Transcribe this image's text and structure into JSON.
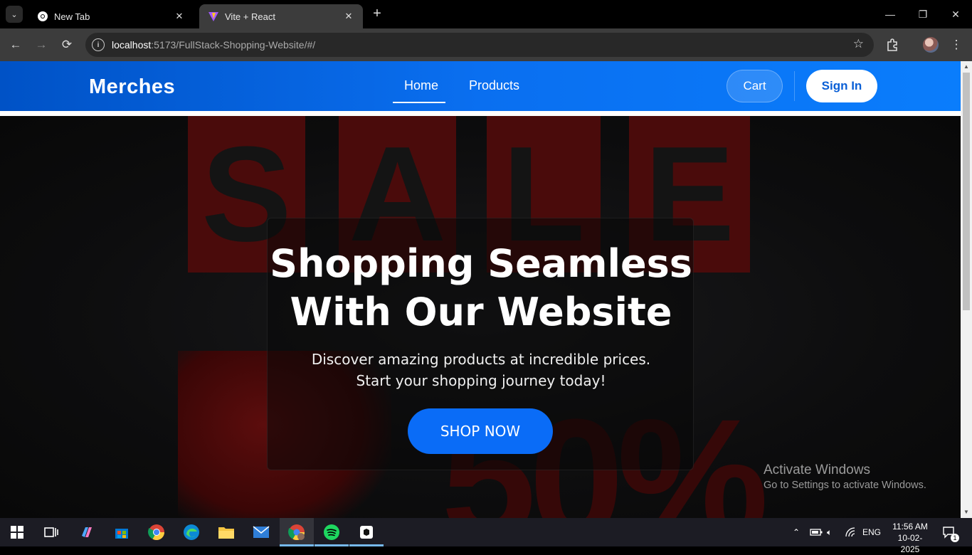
{
  "browser": {
    "tabs": [
      {
        "title": "New Tab",
        "favicon": "chrome-icon"
      },
      {
        "title": "Vite + React",
        "favicon": "vite-icon"
      }
    ],
    "url_host": "localhost",
    "url_rest": ":5173/FullStack-Shopping-Website/#/"
  },
  "nav": {
    "brand": "Merches",
    "links": [
      "Home",
      "Products"
    ],
    "cart_label": "Cart",
    "signin_label": "Sign In"
  },
  "hero": {
    "bg_text": "SALE",
    "bg_percent": "50%",
    "title_line1": "Shopping Seamless",
    "title_line2": "With Our Website",
    "subtitle": "Discover amazing products at incredible prices. Start your shopping journey today!",
    "cta_label": "SHOP NOW"
  },
  "watermark": {
    "title": "Activate Windows",
    "subtitle": "Go to Settings to activate Windows."
  },
  "taskbar": {
    "language": "ENG",
    "time": "11:56 AM",
    "date": "10-02-2025",
    "notifications": "1"
  },
  "colors": {
    "accent": "#0a6cf7",
    "nav_gradient_start": "#0052c6",
    "nav_gradient_end": "#0a7dfc"
  }
}
